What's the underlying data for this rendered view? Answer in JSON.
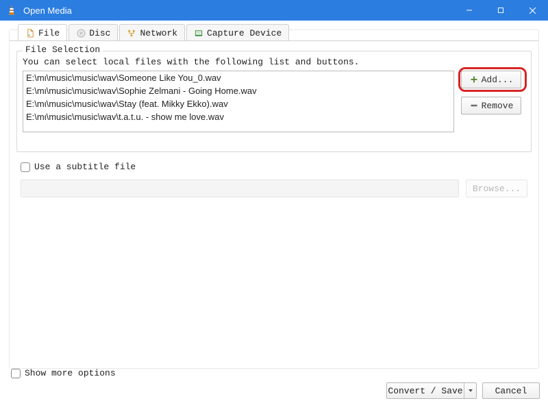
{
  "window": {
    "title": "Open Media"
  },
  "tabs": {
    "file": "File",
    "disc": "Disc",
    "network": "Network",
    "capture": "Capture Device"
  },
  "file_selection": {
    "title": "File Selection",
    "desc": "You can select local files with the following list and buttons.",
    "files": [
      "E:\\mι\\music\\music\\wav\\Someone Like You_0.wav",
      "E:\\mι\\music\\music\\wav\\Sophie Zelmani - Going Home.wav",
      "E:\\mι\\music\\music\\wav\\Stay (feat. Mikky Ekko).wav",
      "E:\\mι\\music\\music\\wav\\t.a.t.u. - show me love.wav"
    ],
    "add_label": "Add...",
    "remove_label": "Remove"
  },
  "subtitle": {
    "checkbox_label": "Use a subtitle file",
    "browse_label": "Browse..."
  },
  "more_options_label": "Show more options",
  "bottom": {
    "convert_label": "Convert / Save",
    "cancel_label": "Cancel"
  }
}
